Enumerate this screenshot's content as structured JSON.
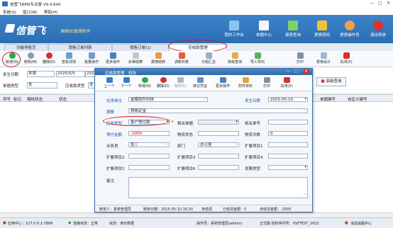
{
  "window": {
    "title": "信管飞RMS专业版 V9.4.640",
    "min": "—",
    "max": "□",
    "close": "✕"
  },
  "menu": [
    "系统(S)",
    "窗口(W)",
    "帮助(H)"
  ],
  "brand": {
    "logo": "信管飞",
    "slogan": "精细化管理软件",
    "accent": "#2a6db3"
  },
  "header_buttons": [
    {
      "label": "我的工作台",
      "icon": "monitor-icon"
    },
    {
      "label": "单据中心",
      "icon": "documents-icon"
    },
    {
      "label": "报表查询",
      "icon": "report-icon"
    },
    {
      "label": "更换密码",
      "icon": "lock-icon"
    },
    {
      "label": "更换操作员",
      "icon": "user-icon"
    },
    {
      "label": "退出系统",
      "icon": "exit-icon"
    }
  ],
  "doc_tabs": [
    "功能导航页",
    "销售订单列表",
    "销售订单(1)",
    "应收款管理"
  ],
  "toolbar": [
    "新增(N)",
    "修改(M)",
    "删除(D)",
    "查看详情",
    "批量操作",
    "更多操作",
    "反审结算",
    "费用结转",
    "调账补款",
    "分组汇总",
    "高级查询",
    "导入导出",
    "打印",
    "费用设计",
    "关闭(X)"
  ],
  "filter": {
    "date_label": "发生日期",
    "period": "本周",
    "date_from": "2025/5/5",
    "date_to": "202",
    "doc_type_label": "单据类型",
    "doc_type_value": "全",
    "receivable_label": "应收款类型",
    "receivable_value": "全",
    "search_button": "高级查询"
  },
  "grid_columns": [
    "序号",
    "标记",
    "稽核状态",
    "状态",
    "单据编号",
    "自定义编号"
  ],
  "dialog": {
    "title": "应收款管理 - 修改",
    "toolbar": [
      "上一个",
      "下一个",
      "新增(N)",
      "删除(D)",
      "保存(S)",
      "转记凭证",
      "更多操作",
      "附件资料",
      "打印",
      "关闭(X)"
    ],
    "fields": {
      "party_label": "往来单位",
      "party_value": "金蝶软件科技",
      "date_label": "发生日期",
      "date_value": "2025-05-10",
      "summary_label": "摘要",
      "summary_value": "预收定金",
      "type_label": "应收类型",
      "type_value": "客户预付款",
      "related_doc_label": "相关单据",
      "related_no_label": "相关单号",
      "amount_label": "预付金额",
      "amount_value": "-2000",
      "status_label": "物流状态",
      "logistics_no_label": "物流单号",
      "logistics_count_label": "物流次数",
      "logistics_count_value": "0",
      "staff_label": "业务员",
      "staff_value": "张三",
      "dept_label": "部门",
      "dept_value": "办公室",
      "ext1": "扩展项目1",
      "ext2": "扩展项目2",
      "ext3": "扩展项目3",
      "ext4": "扩展项目4",
      "ext5": "扩展项目5",
      "ext6": "扩展项目6",
      "invoice_label": "发票类型",
      "remark_label": "备注"
    },
    "status": {
      "maker": "制单人：系统管理员",
      "make_time": "制单日期：2025-05-10 16:20",
      "audit": "未结清",
      "settled": "已结清金额：0",
      "unsettled": "未结清金额：-2000"
    }
  },
  "statusbar": {
    "app_center": "应用中心：127.0.0.1:7899",
    "conn": "连接状态：正常",
    "ready": "状态：演示数据",
    "operator": "操作员：系统管理员(admin)",
    "version": "正式版  授权序列号：XSFTEST_2022",
    "msg": "消息提醒中心"
  }
}
